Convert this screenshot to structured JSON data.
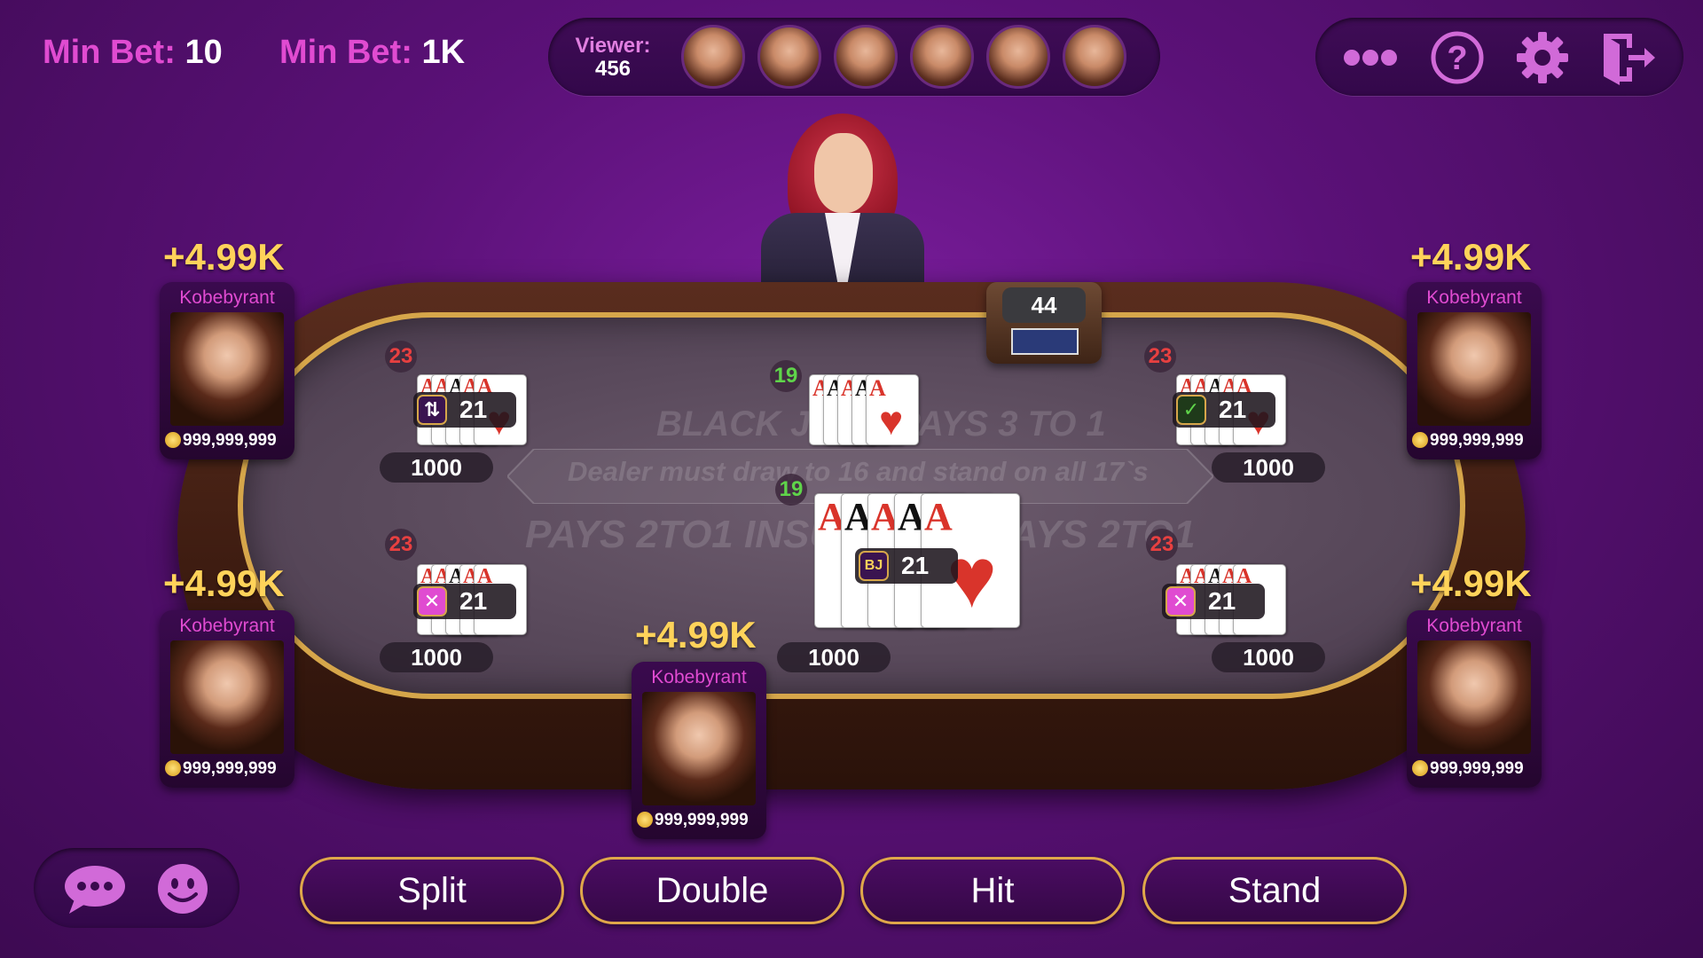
{
  "top": {
    "min_bet_1": {
      "label": "Min Bet:",
      "value": "10"
    },
    "min_bet_2": {
      "label": "Min Bet:",
      "value": "1K"
    },
    "viewer_label": "Viewer:",
    "viewer_count": "456"
  },
  "menu": {
    "more_icon": "more-dots-icon",
    "help_icon": "help-icon",
    "settings_icon": "gear-icon",
    "exit_icon": "exit-icon"
  },
  "table": {
    "line1": "BLACK JACK PAYS 3 TO 1",
    "line2": "Dealer must draw to 16 and stand on all 17`s",
    "line3": "PAYS 2TO1   INSURANCE   PAYS 2TO1",
    "shoe_count": "44"
  },
  "dealer_hand": {
    "count": "19"
  },
  "center_hand": {
    "count": "19",
    "badge": "BJ",
    "score": "21",
    "bet": "1000"
  },
  "hands": [
    {
      "id": "top-left",
      "count": "23",
      "score": "21",
      "bet": "1000",
      "status": "split"
    },
    {
      "id": "top-right",
      "count": "23",
      "score": "21",
      "bet": "1000",
      "status": "check"
    },
    {
      "id": "bottom-left",
      "count": "23",
      "score": "21",
      "bet": "1000",
      "status": "cross"
    },
    {
      "id": "bottom-right",
      "count": "23",
      "score": "21",
      "bet": "1000",
      "status": "cross"
    }
  ],
  "players": [
    {
      "name": "Kobebyrant",
      "coins": "999,999,999",
      "winnings": "+4.99K"
    },
    {
      "name": "Kobebyrant",
      "coins": "999,999,999",
      "winnings": "+4.99K"
    },
    {
      "name": "Kobebyrant",
      "coins": "999,999,999",
      "winnings": "+4.99K"
    },
    {
      "name": "Kobebyrant",
      "coins": "999,999,999",
      "winnings": "+4.99K"
    },
    {
      "name": "Kobebyrant",
      "coins": "999,999,999",
      "winnings": "+4.99K"
    }
  ],
  "actions": {
    "split": "Split",
    "double": "Double",
    "hit": "Hit",
    "stand": "Stand"
  },
  "card_rank": "A",
  "colors": {
    "accent": "#e04bd1",
    "gold": "#ffd35a",
    "button_border": "#e0a84a"
  }
}
